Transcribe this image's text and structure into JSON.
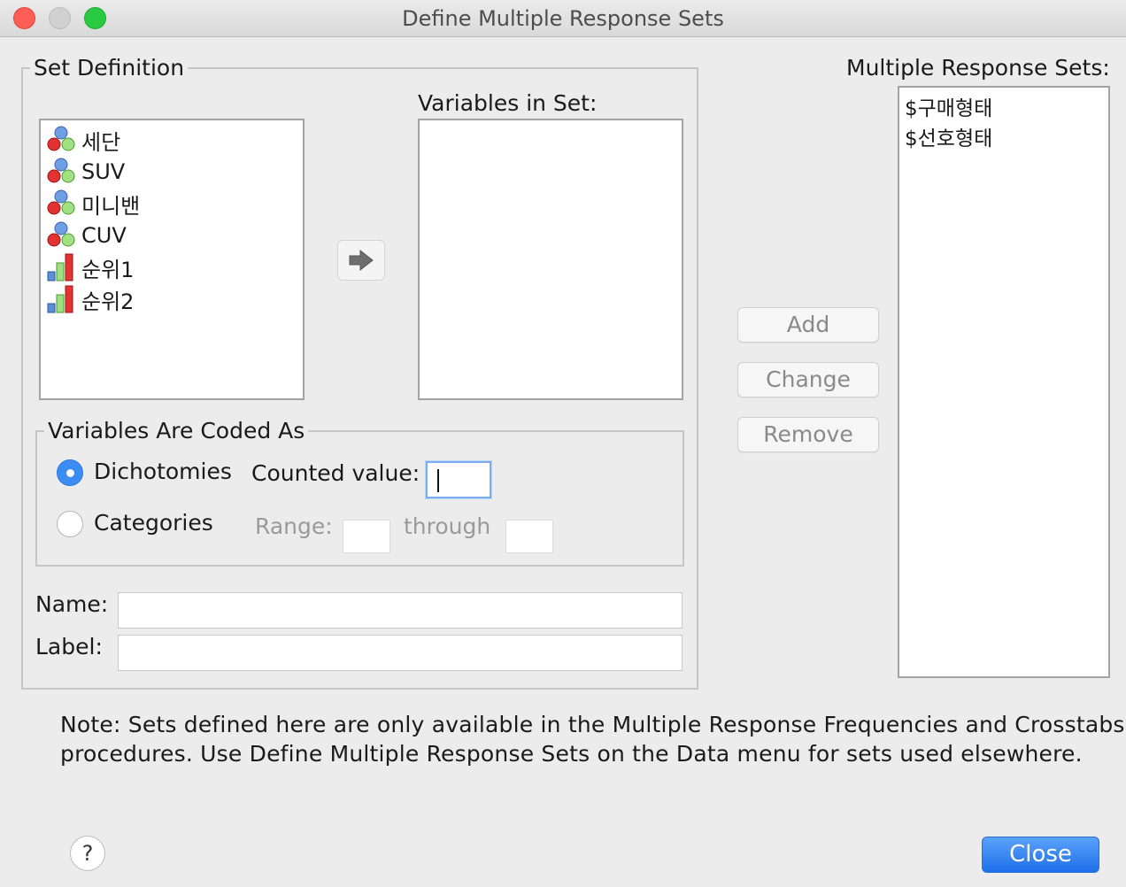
{
  "window": {
    "title": "Define Multiple Response Sets"
  },
  "set_definition": {
    "legend": "Set Definition",
    "variables": [
      {
        "label": "세단",
        "icon": "nominal-icon"
      },
      {
        "label": "SUV",
        "icon": "nominal-icon"
      },
      {
        "label": "미니밴",
        "icon": "nominal-icon"
      },
      {
        "label": "CUV",
        "icon": "nominal-icon"
      },
      {
        "label": "순위1",
        "icon": "ordinal-icon"
      },
      {
        "label": "순위2",
        "icon": "ordinal-icon"
      }
    ],
    "variables_in_set_label": "Variables in Set:",
    "coded_as": {
      "legend": "Variables Are Coded As",
      "dichotomies_label": "Dichotomies",
      "categories_label": "Categories",
      "selected": "Dichotomies",
      "counted_value_label": "Counted value:",
      "counted_value": "",
      "range_label": "Range:",
      "through_label": "through"
    },
    "name_label": "Name:",
    "name_value": "",
    "label_label": "Label:",
    "label_value": ""
  },
  "buttons": {
    "add": "Add",
    "change": "Change",
    "remove": "Remove",
    "close": "Close",
    "help": "?"
  },
  "multiple_response_sets": {
    "label": "Multiple Response Sets:",
    "items": [
      "$구매형태",
      "$선호형태"
    ]
  },
  "note": {
    "line1": "Note: Sets defined here are only available in the Multiple Response Frequencies and Crosstabs",
    "line2": "procedures. Use Define Multiple Response Sets on the Data menu for sets used elsewhere."
  },
  "colors": {
    "accent": "#3b8cf3",
    "close_button": "#1e6fea"
  }
}
